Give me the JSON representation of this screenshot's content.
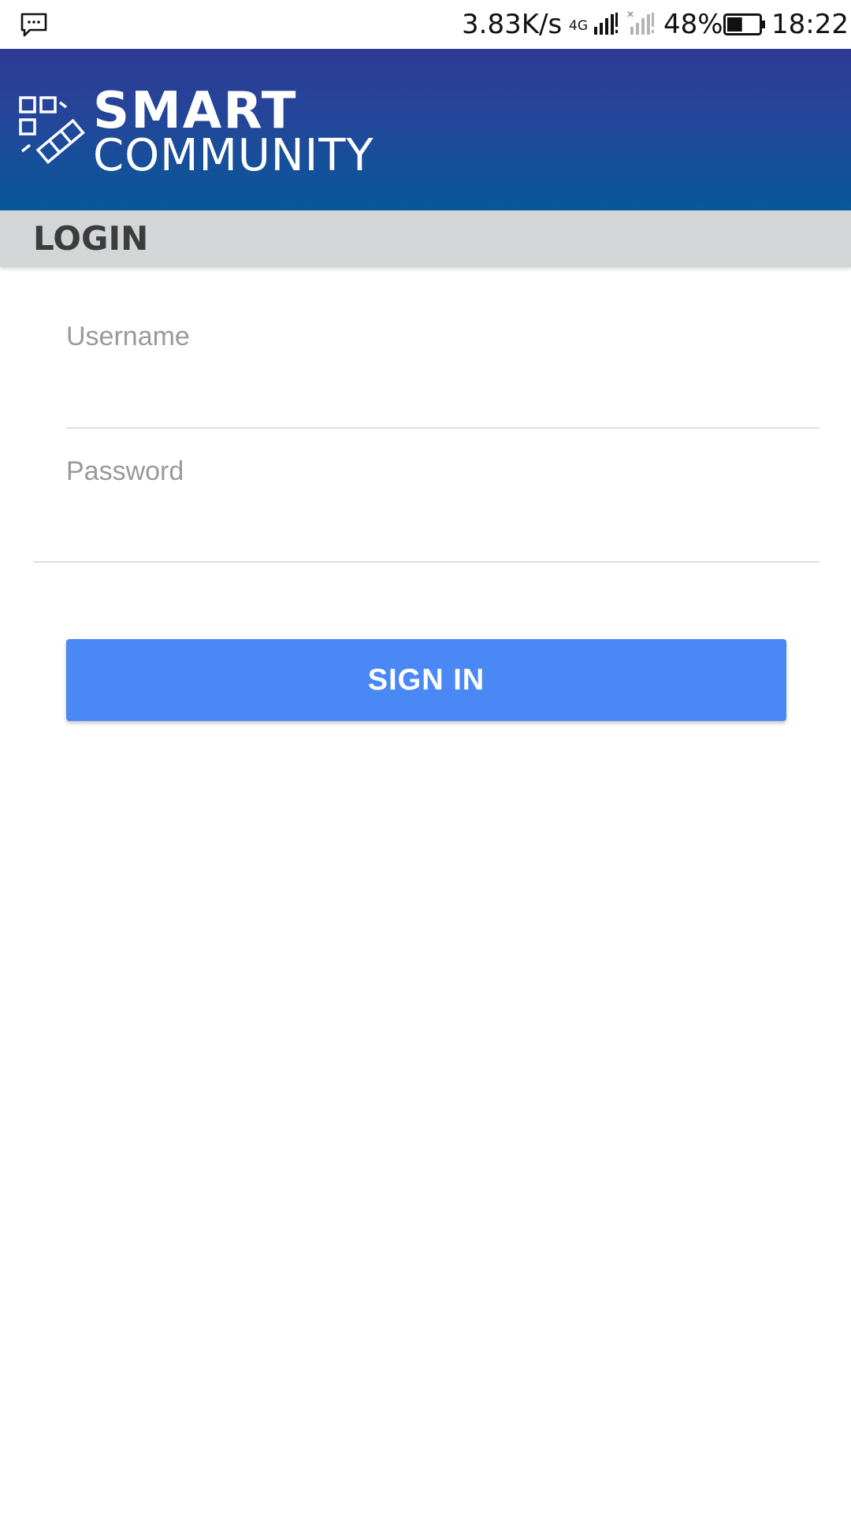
{
  "status_bar": {
    "notification_icon": "message-icon",
    "net_speed": "3.83K/s",
    "network_type": "4G",
    "battery_percent": "48%",
    "battery_level": 0.48,
    "time": "18:22"
  },
  "header": {
    "brand_line1": "SMART",
    "brand_line2": "COMMUNITY",
    "logo_icon": "smart-community-logo-icon",
    "gradient_top": "#2e3a94",
    "gradient_bottom": "#08589a"
  },
  "title_bar": {
    "title": "LOGIN"
  },
  "form": {
    "username": {
      "label": "Username",
      "value": ""
    },
    "password": {
      "label": "Password",
      "value": ""
    },
    "submit_label": "SIGN IN",
    "submit_color": "#4a89f5"
  }
}
